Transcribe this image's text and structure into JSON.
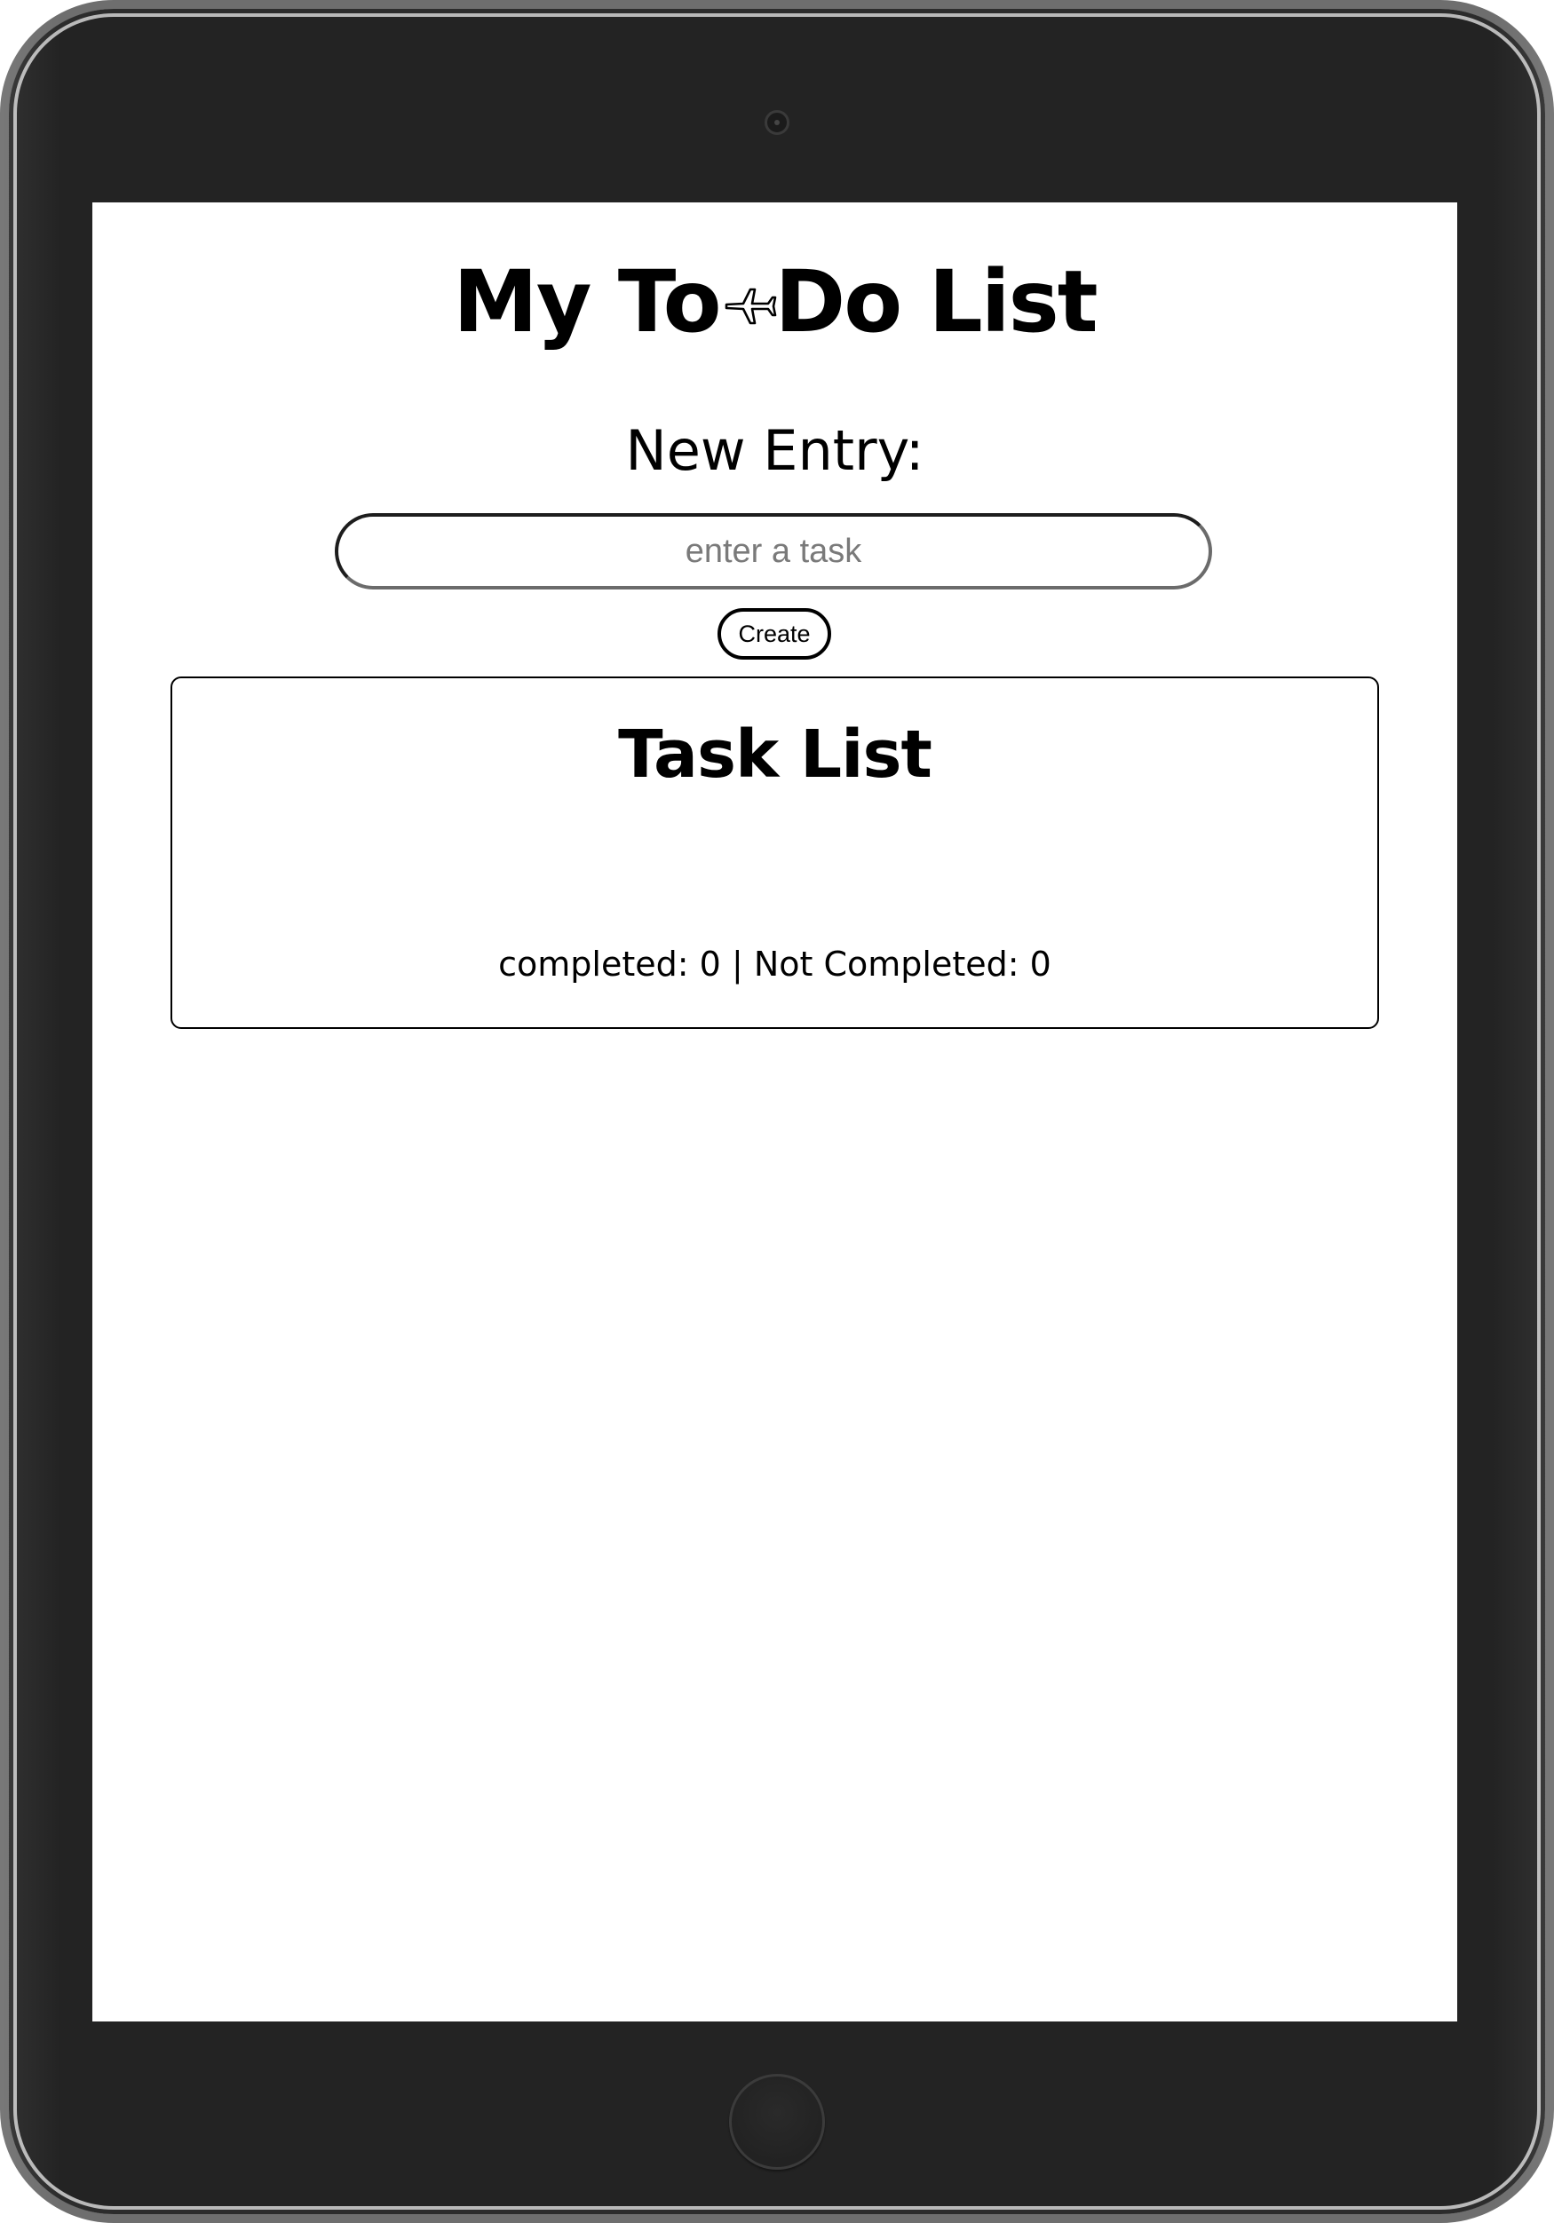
{
  "header": {
    "title_before": "My To",
    "title_icon": "airplane-icon",
    "title_after": "Do List"
  },
  "entry": {
    "label": "New Entry:",
    "input_value": "",
    "input_placeholder": "enter a task",
    "create_label": "Create"
  },
  "task_panel": {
    "title": "Task List",
    "tasks": [],
    "completed_label": "completed:",
    "completed_count": "0",
    "separator": "|",
    "not_completed_label": "Not Completed:",
    "not_completed_count": "0"
  },
  "colors": {
    "bezel": "#232323",
    "screen_background": "#ffffff",
    "text": "#000000",
    "placeholder": "#7a7a7a"
  }
}
